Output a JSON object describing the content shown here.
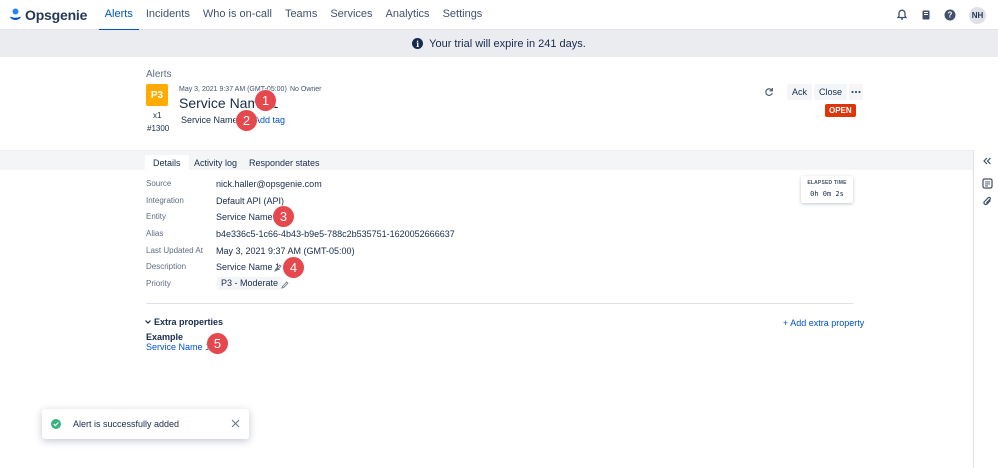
{
  "app": {
    "logo_text": "Opsgenie"
  },
  "nav": {
    "items": [
      {
        "label": "Alerts",
        "active": true
      },
      {
        "label": "Incidents"
      },
      {
        "label": "Who is on-call"
      },
      {
        "label": "Teams"
      },
      {
        "label": "Services"
      },
      {
        "label": "Analytics"
      },
      {
        "label": "Settings"
      }
    ],
    "icons": [
      "notification-bell-icon",
      "runbook-book-icon",
      "help-icon"
    ],
    "avatar_initials": "NH"
  },
  "banner": {
    "text": "Your trial will expire in 241 days.",
    "icon": "info-icon"
  },
  "alert": {
    "breadcrumb": "Alerts",
    "priority": "P3",
    "priority_color": "#ffab00",
    "count": "x1",
    "tiny_id": "#1300",
    "created_at": "May 3, 2021 9:37 AM (GMT-05:00)",
    "owner": "No Owner",
    "title": "Service Name 1",
    "tag": "Service Name 1",
    "add_tag_label": "Add tag",
    "actions": {
      "ack": "Ack",
      "close": "Close"
    },
    "status": "OPEN",
    "status_color": "#de350b"
  },
  "tabs": [
    {
      "label": "Details",
      "active": true
    },
    {
      "label": "Activity log"
    },
    {
      "label": "Responder states"
    }
  ],
  "details": {
    "fields": [
      {
        "label": "Source",
        "value": "nick.haller@opsgenie.com"
      },
      {
        "label": "Integration",
        "value": "Default API (API)"
      },
      {
        "label": "Entity",
        "value": "Service Name 1"
      },
      {
        "label": "Alias",
        "value": "b4e336c5-1c66-4b43-b9e5-788c2b535751-1620052666637"
      },
      {
        "label": "Last Updated At",
        "value": "May 3, 2021 9:37 AM (GMT-05:00)"
      },
      {
        "label": "Description",
        "value": "Service Name 1"
      },
      {
        "label": "Priority",
        "value": "P3 - Moderate"
      }
    ],
    "elapsed": {
      "label": "ELAPSED TIME",
      "value": "0h 0m 2s"
    }
  },
  "extra": {
    "title": "Extra properties",
    "add_label": "+ Add extra property",
    "items": [
      {
        "key": "Example",
        "value": "Service Name 1"
      }
    ]
  },
  "markers": [
    "1",
    "2",
    "3",
    "4",
    "5"
  ],
  "marker_color": "#e5484d",
  "toast": {
    "text": "Alert is successfully added",
    "icon": "success-check-icon"
  },
  "sidebar_icons": [
    "collapse-chevrons-icon",
    "notes-icon",
    "attachment-icon"
  ]
}
